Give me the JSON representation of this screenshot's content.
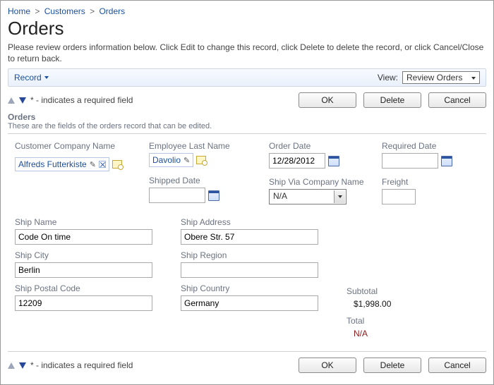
{
  "breadcrumb": {
    "home": "Home",
    "customers": "Customers",
    "orders": "Orders"
  },
  "page": {
    "title": "Orders",
    "description": "Please review orders information below. Click Edit to change this record, click Delete to delete the record, or click Cancel/Close to return back."
  },
  "bar": {
    "record": "Record",
    "viewLabel": "View:",
    "viewValue": "Review Orders"
  },
  "actions": {
    "ok": "OK",
    "delete": "Delete",
    "cancel": "Cancel",
    "reqNote": "* - indicates a required field"
  },
  "section": {
    "title": "Orders",
    "desc": "These are the fields of the orders record that can be edited."
  },
  "labels": {
    "customerCompany": "Customer Company Name",
    "employeeLast": "Employee Last Name",
    "orderDate": "Order Date",
    "requiredDate": "Required Date",
    "shippedDate": "Shipped Date",
    "shipViaCompany": "Ship Via Company Name",
    "freight": "Freight",
    "shipName": "Ship Name",
    "shipAddress": "Ship Address",
    "shipCity": "Ship City",
    "shipRegion": "Ship Region",
    "shipPostal": "Ship Postal Code",
    "shipCountry": "Ship Country",
    "subtotal": "Subtotal",
    "total": "Total"
  },
  "values": {
    "customerCompany": "Alfreds Futterkiste",
    "employeeLast": "Davolio",
    "orderDate": "12/28/2012",
    "requiredDate": "",
    "shippedDate": "",
    "shipVia": "N/A",
    "freight": "",
    "shipName": "Code On time",
    "shipAddress": "Obere Str. 57",
    "shipCity": "Berlin",
    "shipRegion": "",
    "shipPostal": "12209",
    "shipCountry": "Germany",
    "subtotal": "$1,998.00",
    "total": "N/A"
  }
}
